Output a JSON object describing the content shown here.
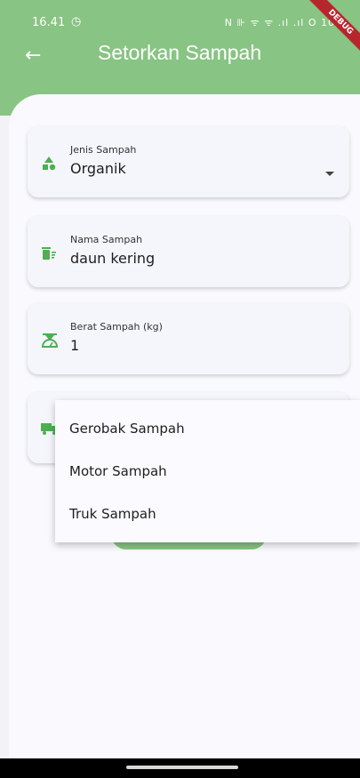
{
  "status_bar": {
    "time": "16.41",
    "icons": "N ⊪ ᯤ ᯤ .ıl .ıl O 100"
  },
  "debug_banner": "DEBUG",
  "app_bar": {
    "title": "Setorkan Sampah"
  },
  "fields": {
    "jenis": {
      "label": "Jenis Sampah",
      "value": "Organik"
    },
    "nama": {
      "label": "Nama Sampah",
      "value": "daun kering"
    },
    "berat": {
      "label": "Berat Sampah (kg)",
      "value": "1"
    }
  },
  "vehicle_menu": {
    "options": [
      "Gerobak Sampah",
      "Motor Sampah",
      "Truk Sampah"
    ]
  },
  "colors": {
    "accent": "#88c483",
    "icon_green": "#4caf50"
  }
}
